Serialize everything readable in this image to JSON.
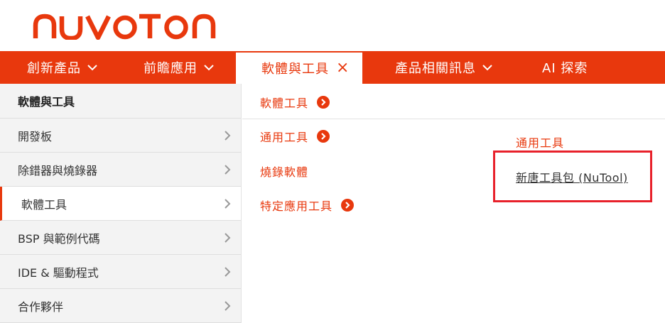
{
  "brand": {
    "logo_text": "nuvoTon",
    "color": "#e8380d"
  },
  "nav": {
    "items": [
      {
        "label": "創新產品",
        "has_chevron": true
      },
      {
        "label": "前瞻應用",
        "has_chevron": true
      },
      {
        "label": "軟體與工具",
        "active": true,
        "close_icon": "×"
      },
      {
        "label": "產品相關訊息",
        "has_chevron": true
      },
      {
        "label": "AI 探索"
      }
    ]
  },
  "sidebar": {
    "heading": "軟體與工具",
    "items": [
      {
        "label": "開發板"
      },
      {
        "label": "除錯器與燒錄器"
      },
      {
        "label": "軟體工具",
        "active": true
      },
      {
        "label": "BSP 與範例代碼"
      },
      {
        "label": "IDE & 驅動程式"
      },
      {
        "label": "合作夥伴"
      }
    ]
  },
  "submenu": {
    "items": [
      {
        "label": "軟體工具",
        "icon": "chevron-circle-right-icon"
      },
      {
        "label": "通用工具",
        "icon": "chevron-circle-right-icon"
      },
      {
        "label": "燒錄軟體"
      },
      {
        "label": "特定應用工具",
        "icon": "chevron-circle-right-icon"
      }
    ]
  },
  "detail": {
    "title": "通用工具",
    "link": "新唐工具包 (NuTool)",
    "highlight_color": "#e8212b"
  }
}
